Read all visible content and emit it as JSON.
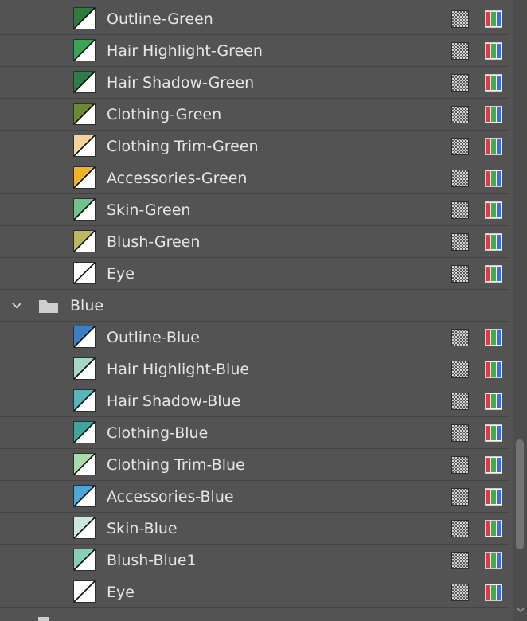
{
  "swatches_panel": {
    "rows_above": [
      {
        "label": "Outline-Green",
        "color": "#2f7a3c",
        "icon": "swatch-icon"
      },
      {
        "label": "Hair Highlight-Green",
        "color": "#3aa35a",
        "icon": "swatch-icon"
      },
      {
        "label": "Hair Shadow-Green",
        "color": "#2e7d46",
        "icon": "swatch-icon"
      },
      {
        "label": "Clothing-Green",
        "color": "#6c8a34",
        "icon": "swatch-icon"
      },
      {
        "label": "Clothing Trim-Green",
        "color": "#f4d39c",
        "icon": "swatch-icon"
      },
      {
        "label": "Accessories-Green",
        "color": "#f0b324",
        "icon": "swatch-icon"
      },
      {
        "label": "Skin-Green",
        "color": "#6fc48a",
        "icon": "swatch-icon"
      },
      {
        "label": "Blush-Green",
        "color": "#bdb860",
        "icon": "swatch-icon"
      },
      {
        "label": "Eye",
        "color": "#ffffff",
        "icon": "swatch-icon"
      }
    ],
    "group": {
      "label": "Blue",
      "expanded": true,
      "chevron_icon": "chevron-down-icon",
      "folder_icon": "folder-icon"
    },
    "group_rows": [
      {
        "label": "Outline-Blue",
        "color": "#3a7fc0",
        "icon": "swatch-icon"
      },
      {
        "label": "Hair Highlight-Blue",
        "color": "#a6d6c9",
        "icon": "swatch-icon"
      },
      {
        "label": "Hair Shadow-Blue",
        "color": "#5ab3b8",
        "icon": "swatch-icon"
      },
      {
        "label": "Clothing-Blue",
        "color": "#41a39b",
        "icon": "swatch-icon"
      },
      {
        "label": "Clothing Trim-Blue",
        "color": "#a9dca8",
        "icon": "swatch-icon"
      },
      {
        "label": "Accessories-Blue",
        "color": "#4ea6d6",
        "icon": "swatch-icon"
      },
      {
        "label": "Skin-Blue",
        "color": "#c9e8e0",
        "icon": "swatch-icon"
      },
      {
        "label": "Blush-Blue1",
        "color": "#86ceb7",
        "icon": "swatch-icon"
      },
      {
        "label": "Eye",
        "color": "#ffffff",
        "icon": "swatch-icon"
      }
    ],
    "row_icons": {
      "global": "global-color-icon",
      "mode": "rgb-color-mode-icon",
      "mode_colors": [
        "#e03a3a",
        "#3ab04a",
        "#3a6fe0"
      ]
    },
    "colors": {
      "panel_background": "#535353",
      "text": "#e6e6e6",
      "row_divider": "#444444"
    }
  }
}
